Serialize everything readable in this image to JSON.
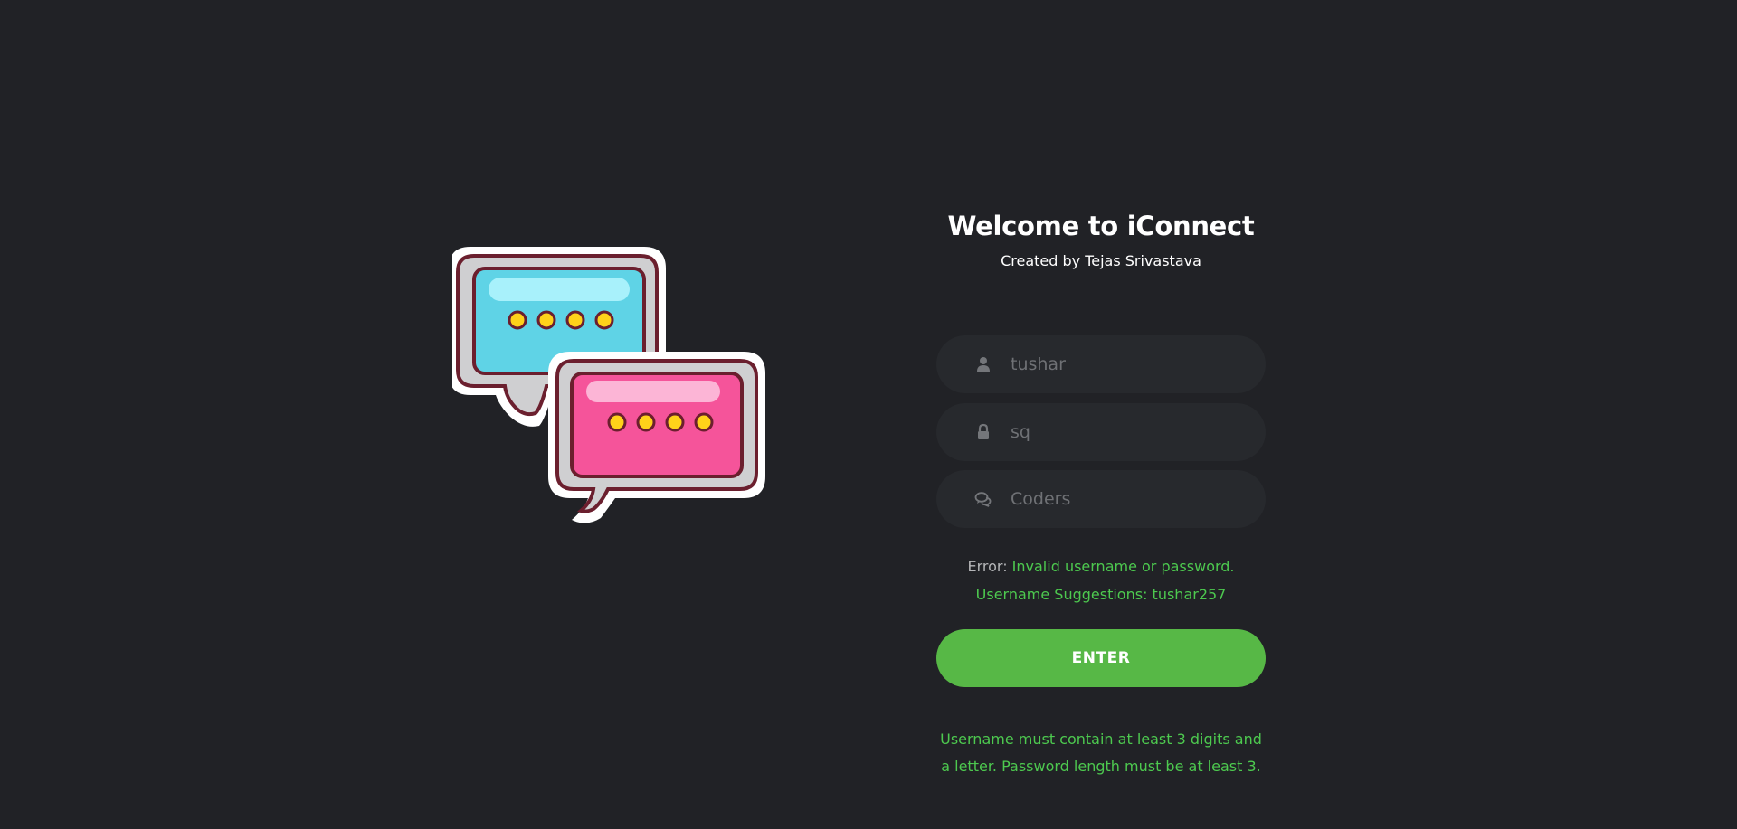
{
  "header": {
    "title": "Welcome to iConnect",
    "subtitle": "Created by Tejas Srivastava"
  },
  "form": {
    "username": {
      "value": "",
      "placeholder": "tushar",
      "icon": "user-icon"
    },
    "password": {
      "value": "",
      "placeholder": "sq",
      "icon": "lock-icon"
    },
    "room": {
      "value": "",
      "placeholder": "Coders",
      "icon": "chat-bubbles-icon"
    },
    "error_prefix": "Error:",
    "error_text": "Invalid username or password.",
    "suggestion_label": "Username Suggestions:",
    "suggestion_value": "tushar257",
    "enter_label": "ENTER",
    "rules_line1": "Username must contain at least 3 digits and",
    "rules_line2": "a letter. Password length must be at least 3."
  },
  "illustration": {
    "icon": "chat-bubbles-logo",
    "colors": {
      "blue": "#5fd3e6",
      "pink": "#f5549a",
      "dot": "#ffd21a",
      "outline": "#6b1f2e"
    }
  },
  "colors": {
    "background": "#212226",
    "field": "#27292d",
    "accent": "#57b846",
    "success_text": "#4dc94f"
  }
}
